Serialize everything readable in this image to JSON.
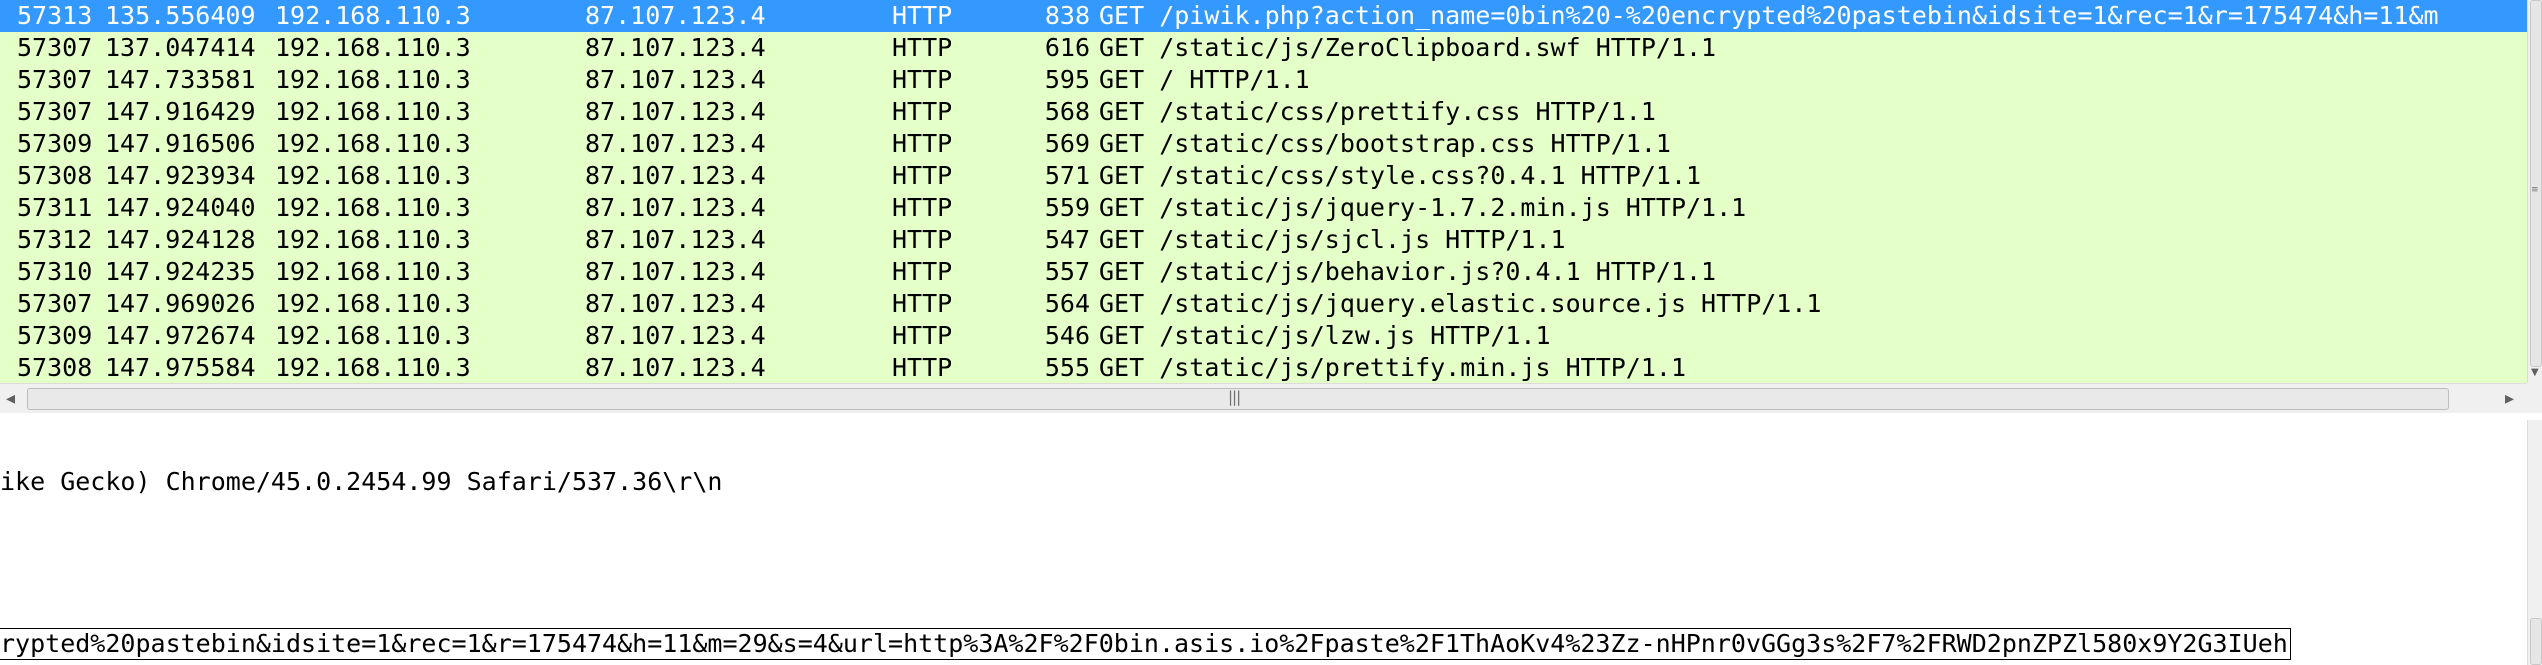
{
  "packet_list": {
    "rows": [
      {
        "tcp_stream": "57313",
        "time": "135.556409",
        "source": "192.168.110.3",
        "destination": "87.107.123.4",
        "protocol": "HTTP",
        "length": "838",
        "info": "GET /piwik.php?action_name=0bin%20-%20encrypted%20pastebin&idsite=1&rec=1&r=175474&h=11&m",
        "selected": true
      },
      {
        "tcp_stream": "57307",
        "time": "137.047414",
        "source": "192.168.110.3",
        "destination": "87.107.123.4",
        "protocol": "HTTP",
        "length": "616",
        "info": "GET /static/js/ZeroClipboard.swf HTTP/1.1",
        "selected": false
      },
      {
        "tcp_stream": "57307",
        "time": "147.733581",
        "source": "192.168.110.3",
        "destination": "87.107.123.4",
        "protocol": "HTTP",
        "length": "595",
        "info": "GET / HTTP/1.1",
        "selected": false
      },
      {
        "tcp_stream": "57307",
        "time": "147.916429",
        "source": "192.168.110.3",
        "destination": "87.107.123.4",
        "protocol": "HTTP",
        "length": "568",
        "info": "GET /static/css/prettify.css HTTP/1.1",
        "selected": false
      },
      {
        "tcp_stream": "57309",
        "time": "147.916506",
        "source": "192.168.110.3",
        "destination": "87.107.123.4",
        "protocol": "HTTP",
        "length": "569",
        "info": "GET /static/css/bootstrap.css HTTP/1.1",
        "selected": false
      },
      {
        "tcp_stream": "57308",
        "time": "147.923934",
        "source": "192.168.110.3",
        "destination": "87.107.123.4",
        "protocol": "HTTP",
        "length": "571",
        "info": "GET /static/css/style.css?0.4.1 HTTP/1.1",
        "selected": false
      },
      {
        "tcp_stream": "57311",
        "time": "147.924040",
        "source": "192.168.110.3",
        "destination": "87.107.123.4",
        "protocol": "HTTP",
        "length": "559",
        "info": "GET /static/js/jquery-1.7.2.min.js HTTP/1.1",
        "selected": false
      },
      {
        "tcp_stream": "57312",
        "time": "147.924128",
        "source": "192.168.110.3",
        "destination": "87.107.123.4",
        "protocol": "HTTP",
        "length": "547",
        "info": "GET /static/js/sjcl.js HTTP/1.1",
        "selected": false
      },
      {
        "tcp_stream": "57310",
        "time": "147.924235",
        "source": "192.168.110.3",
        "destination": "87.107.123.4",
        "protocol": "HTTP",
        "length": "557",
        "info": "GET /static/js/behavior.js?0.4.1 HTTP/1.1",
        "selected": false
      },
      {
        "tcp_stream": "57307",
        "time": "147.969026",
        "source": "192.168.110.3",
        "destination": "87.107.123.4",
        "protocol": "HTTP",
        "length": "564",
        "info": "GET /static/js/jquery.elastic.source.js HTTP/1.1",
        "selected": false
      },
      {
        "tcp_stream": "57309",
        "time": "147.972674",
        "source": "192.168.110.3",
        "destination": "87.107.123.4",
        "protocol": "HTTP",
        "length": "546",
        "info": "GET /static/js/lzw.js HTTP/1.1",
        "selected": false
      },
      {
        "tcp_stream": "57308",
        "time": "147.975584",
        "source": "192.168.110.3",
        "destination": "87.107.123.4",
        "protocol": "HTTP",
        "length": "555",
        "info": "GET /static/js/prettify.min.js HTTP/1.1",
        "selected": false
      }
    ]
  },
  "details": {
    "user_agent_tail": "ike Gecko) Chrome/45.0.2454.99 Safari/537.36\\r\\n",
    "request_uri_tail": "rypted%20pastebin&idsite=1&rec=1&r=175474&h=11&m=29&s=4&url=http%3A%2F%2F0bin.asis.io%2Fpaste%2F1ThAoKv4%23Zz-nHPnr0vGGg3s%2F7%2FRWD2pnZPZl580x9Y2G3IUeh"
  },
  "colors": {
    "row_background": "#e4ffc7",
    "selected_background": "#3399ff",
    "selected_text": "#ffffff"
  },
  "icons": {
    "scroll_left": "scroll-left-arrow-icon",
    "scroll_right": "scroll-right-arrow-icon",
    "grip": "scroll-grip-icon"
  }
}
